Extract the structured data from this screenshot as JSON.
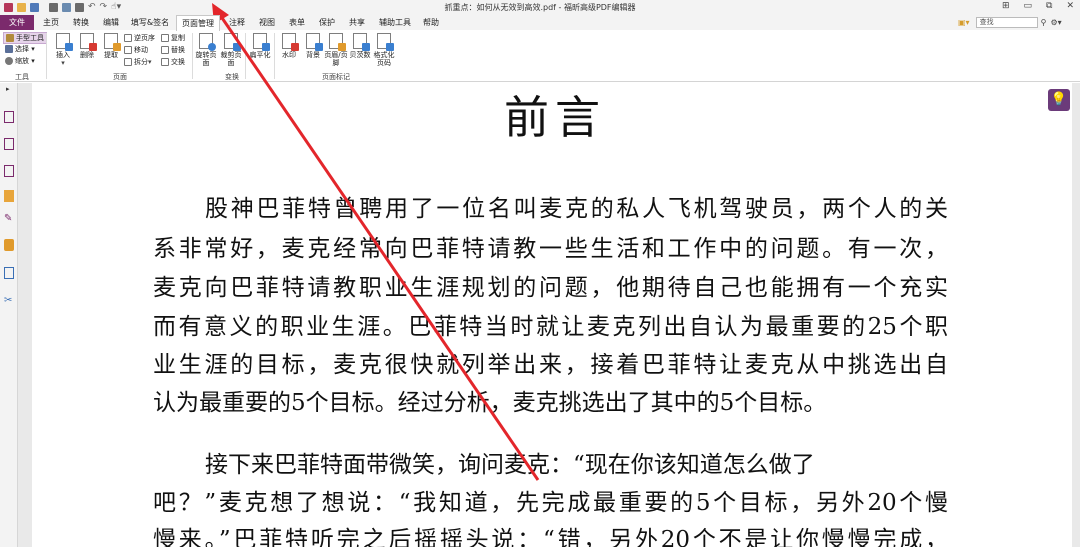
{
  "window": {
    "title": "抓重点：如何从无效到高效.pdf - 福昕高级PDF编辑器",
    "controls": [
      "⊞",
      "▭",
      "⧉",
      "✕"
    ]
  },
  "quick_access": {
    "icons": [
      "app-logo",
      "open-icon",
      "save-icon",
      "print-icon",
      "mail-icon",
      "undo-icon",
      "redo-icon",
      "hand-icon"
    ]
  },
  "tabs": [
    {
      "label": "文件"
    },
    {
      "label": "主页"
    },
    {
      "label": "转换"
    },
    {
      "label": "编辑"
    },
    {
      "label": "填写&签名"
    },
    {
      "label": "页面管理"
    },
    {
      "label": "注释"
    },
    {
      "label": "视图"
    },
    {
      "label": "表单"
    },
    {
      "label": "保护"
    },
    {
      "label": "共享"
    },
    {
      "label": "辅助工具"
    },
    {
      "label": "帮助"
    }
  ],
  "search": {
    "placeholder": "查找"
  },
  "ribbon": {
    "tools": {
      "hand": "手型工具",
      "select": "选择 ▾",
      "zoom": "缩放 ▾",
      "caption": "工具"
    },
    "page_group": {
      "insert": "插入",
      "delete": "删除",
      "extract": "提取",
      "reverse": "逆页序",
      "move": "移动",
      "split": "拆分",
      "copy": "复制",
      "replace": "替换",
      "swap": "交换",
      "caption": "页面"
    },
    "transform_group": {
      "rotate": "旋转页面",
      "crop": "裁剪页面",
      "caption": "变换"
    },
    "flatten": "扁平化",
    "mark_group": {
      "watermark": "水印",
      "background": "背景",
      "header_footer": "页眉/页脚",
      "bates": "贝茨数",
      "format_page_number": "格式化页码",
      "caption": "页面标记"
    }
  },
  "document": {
    "title": "前言",
    "lines": [
      "股神巴菲特曾聘用了一位名叫麦克的私人飞机驾驶员，两个人的关",
      "系非常好，麦克经常向巴菲特请教一些生活和工作中的问题。有一次，",
      "麦克向巴菲特请教职业生涯规划的问题，他期待自己也能拥有一个充实",
      "而有意义的职业生涯。巴菲特当时就让麦克列出自认为最重要的25个职",
      "业生涯的目标，麦克很快就列举出来，接着巴菲特让麦克从中挑选出自",
      "认为最重要的5个目标。经过分析，麦克挑选出了其中的5个目标。",
      "接下来巴菲特面带微笑，询问麦克：“现在你该知道怎么做了",
      "吧？”麦克想了想说：“我知道，先完成最重要的5个目标，另外20个慢",
      "慢来。”巴菲特听完之后摇摇头说：“错，另外20个不是让你慢慢完成，"
    ]
  },
  "colors": {
    "file_tab": "#7b2a6c",
    "arrow": "#e3262b",
    "bulb": "#6b3b7a"
  }
}
